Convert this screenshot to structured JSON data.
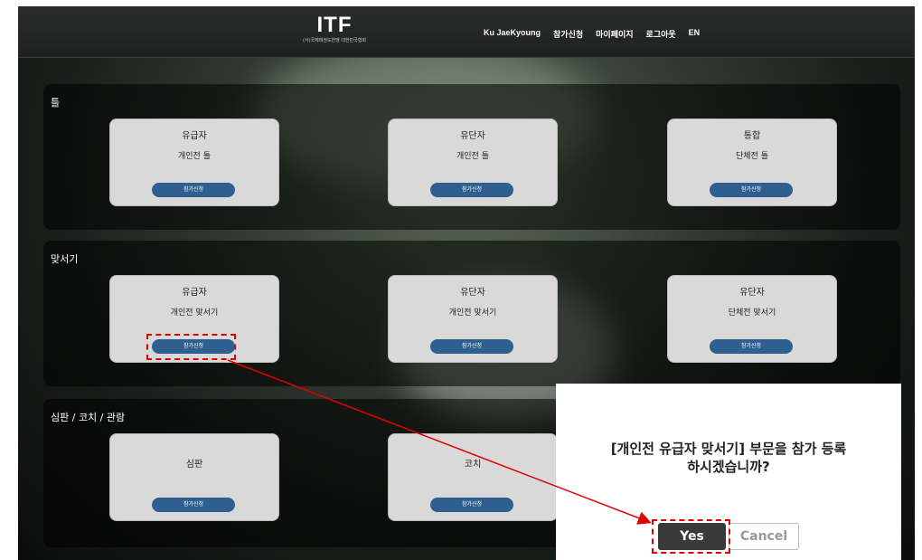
{
  "header": {
    "logo": "ITF",
    "logo_sub": "(사)국제태권도연맹 대한민국협회",
    "nav": [
      "Ku JaeKyoung",
      "참가신청",
      "마이페이지",
      "로그아웃",
      "EN"
    ]
  },
  "sections": [
    {
      "title": "틀",
      "cards": [
        {
          "line1": "유급자",
          "line2": "개인전 틀",
          "button": "참가신청"
        },
        {
          "line1": "유단자",
          "line2": "개인전 틀",
          "button": "참가신청"
        },
        {
          "line1": "통합",
          "line2": "단체전 틀",
          "button": "참가신청"
        }
      ]
    },
    {
      "title": "맞서기",
      "cards": [
        {
          "line1": "유급자",
          "line2": "개인전 맞서기",
          "button": "참가신청"
        },
        {
          "line1": "유단자",
          "line2": "개인전 맞서기",
          "button": "참가신청"
        },
        {
          "line1": "유단자",
          "line2": "단체전 맞서기",
          "button": "참가신청"
        }
      ]
    },
    {
      "title": "심판 / 코치 / 관람",
      "cards": [
        {
          "line1": "심판",
          "line2": "",
          "button": "참가신청"
        },
        {
          "line1": "코치",
          "line2": "",
          "button": "참가신청"
        }
      ]
    }
  ],
  "dialog": {
    "line1": "[개인전 유급자 맞서기] 부문을 참가 등록",
    "line2": "하시겠습니까?",
    "yes": "Yes",
    "cancel": "Cancel"
  },
  "colors": {
    "button_blue": "#2f5f8f",
    "card_bg": "#d9d9d9",
    "highlight_red": "#e00000",
    "yes_bg": "#3a3a3a"
  }
}
